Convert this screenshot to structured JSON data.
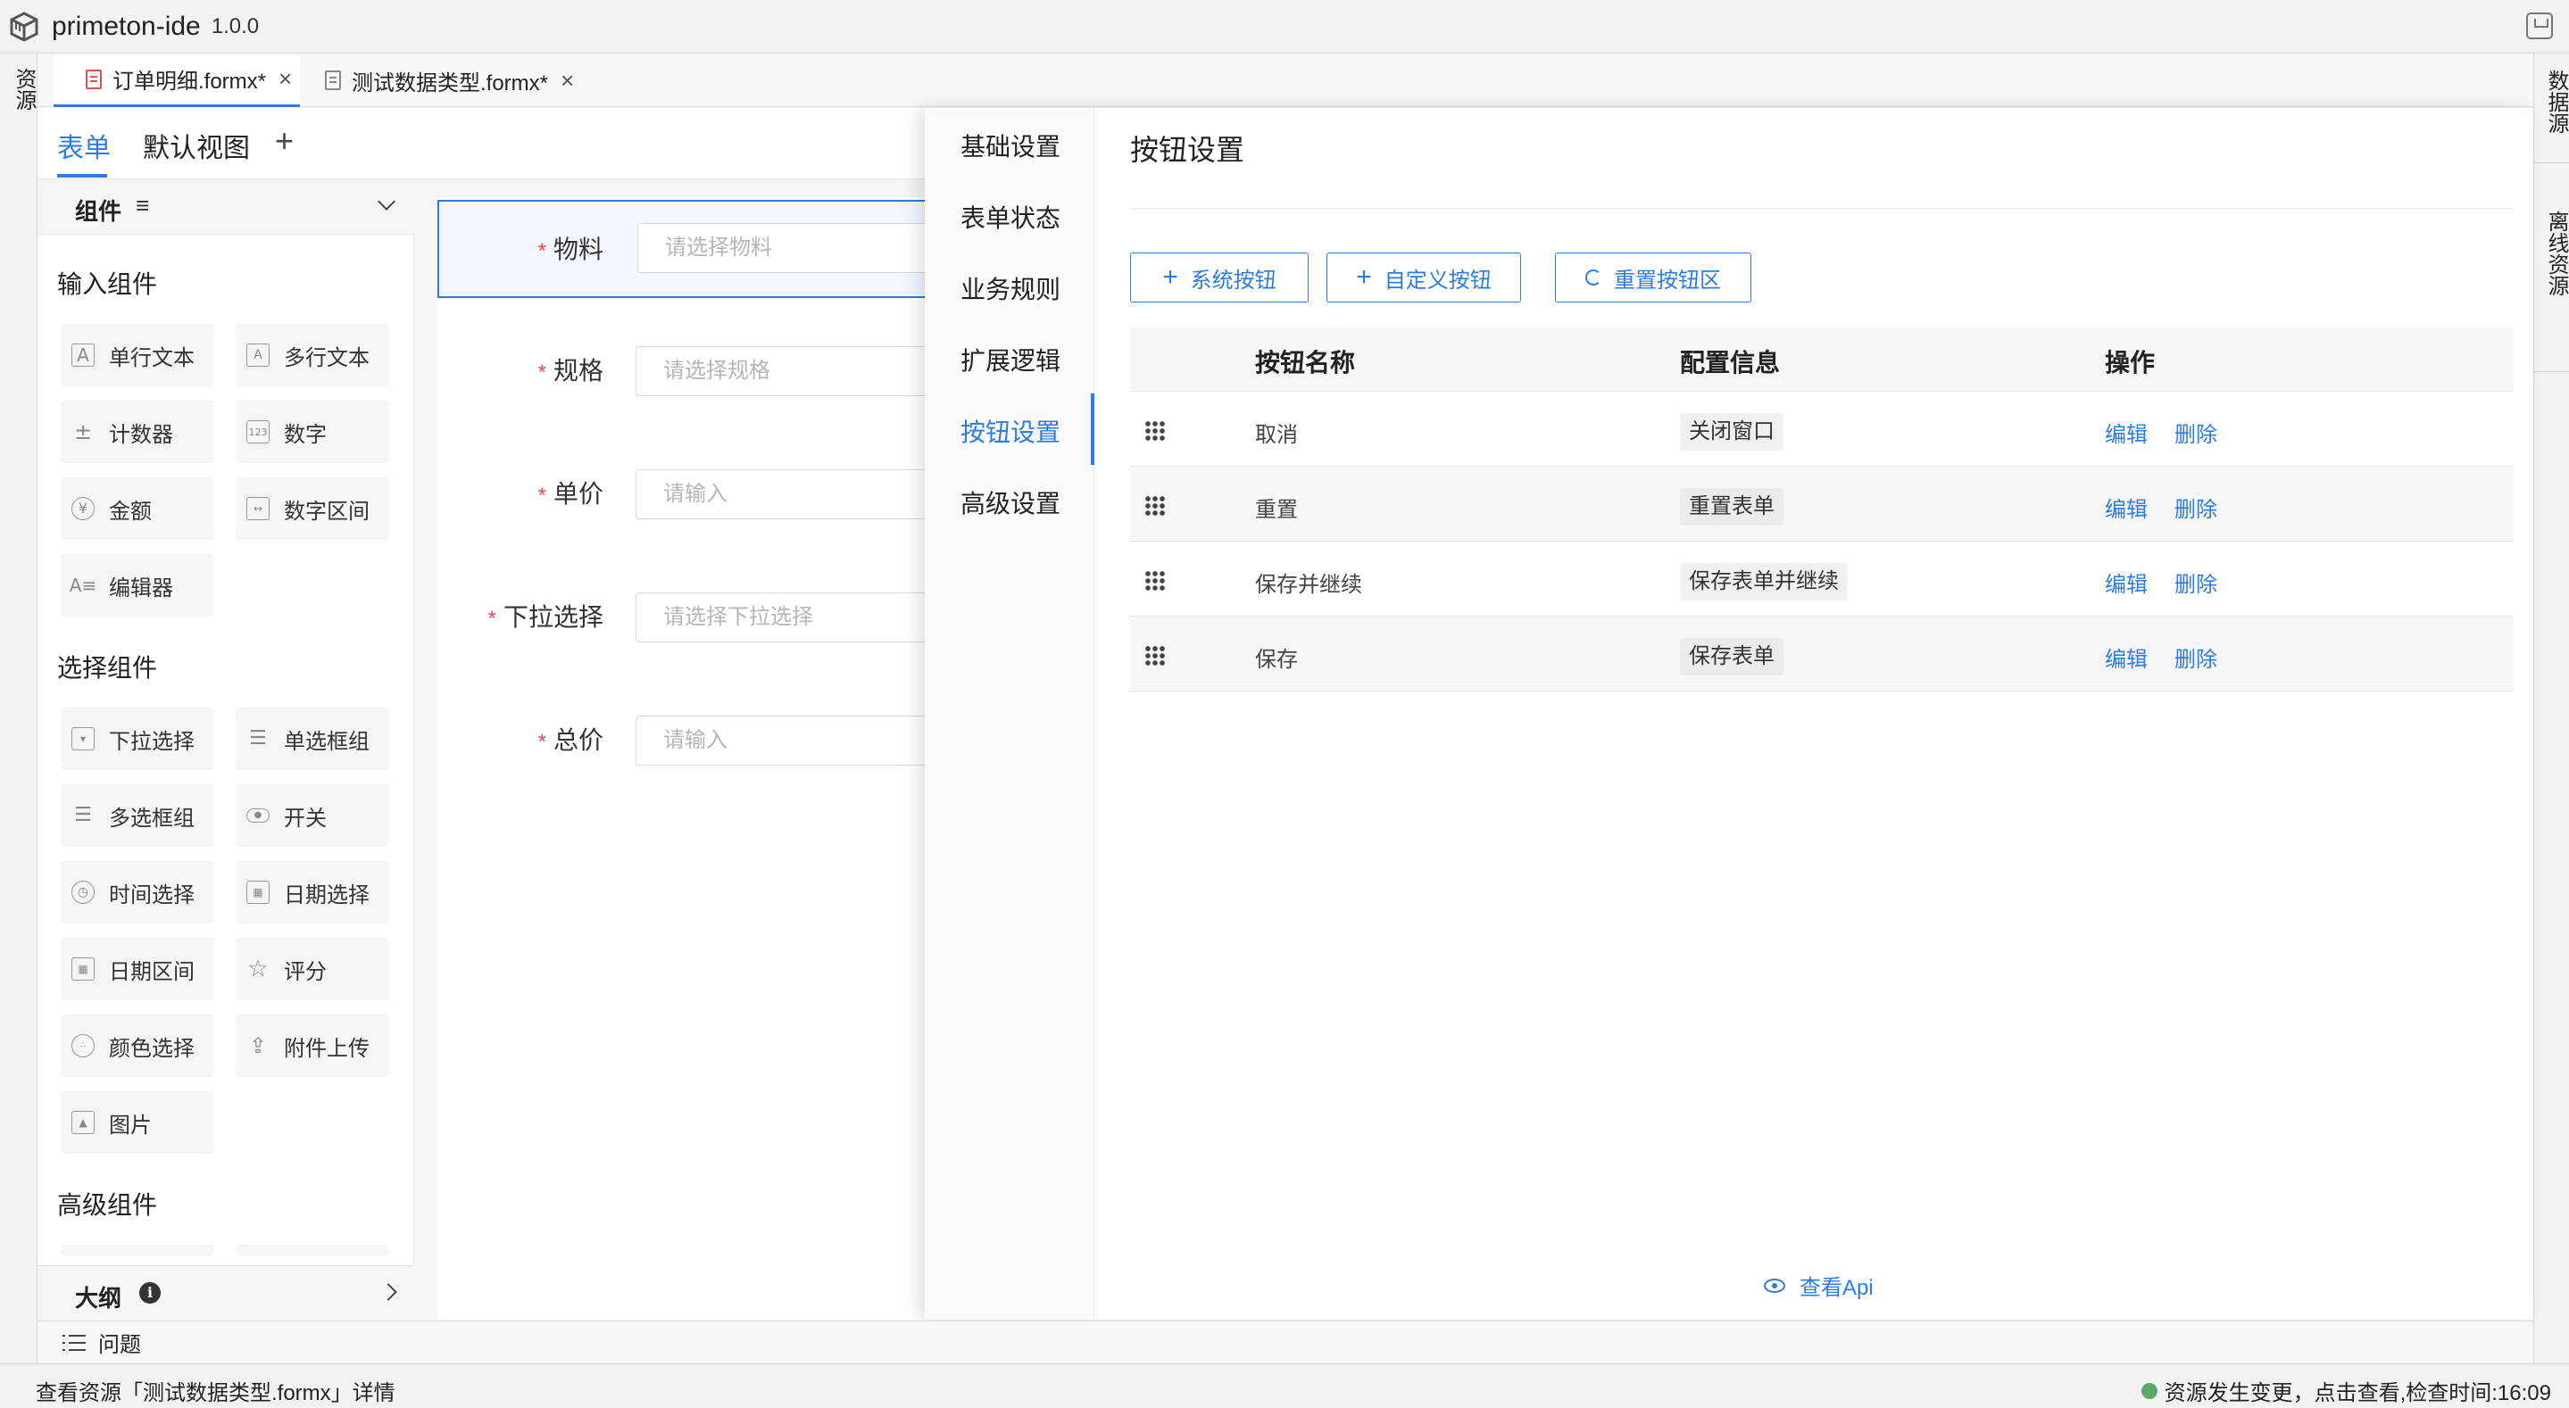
{
  "app": {
    "title": "primeton-ide",
    "version": "1.0.0"
  },
  "left_strip": {
    "resources": "资源"
  },
  "right_strip": {
    "data_source": "数据源",
    "offline_resources": "离线资源"
  },
  "editor_tabs": [
    {
      "label": "订单明细.formx*",
      "active": true
    },
    {
      "label": "测试数据类型.formx*",
      "active": false
    }
  ],
  "view_tabs": [
    {
      "label": "表单",
      "active": true
    },
    {
      "label": "默认视图",
      "active": false
    }
  ],
  "view_tabs_add": "+",
  "components": {
    "header": "组件",
    "header_menu": "≡",
    "groups": [
      {
        "title": "输入组件",
        "items": [
          "单行文本",
          "多行文本",
          "计数器",
          "数字",
          "金额",
          "数字区间",
          "编辑器"
        ]
      },
      {
        "title": "选择组件",
        "items": [
          "下拉选择",
          "单选框组",
          "多选框组",
          "开关",
          "时间选择",
          "日期选择",
          "日期区间",
          "评分",
          "颜色选择",
          "附件上传",
          "图片"
        ]
      },
      {
        "title": "高级组件",
        "items": []
      }
    ],
    "outline": "大纲"
  },
  "form": {
    "fields": [
      {
        "label": "物料",
        "placeholder": "请选择物料",
        "required": true,
        "selected": true
      },
      {
        "label": "规格",
        "placeholder": "请选择规格",
        "required": true,
        "selected": false
      },
      {
        "label": "单价",
        "placeholder": "请输入",
        "required": true,
        "selected": false
      },
      {
        "label": "下拉选择",
        "placeholder": "请选择下拉选择",
        "required": true,
        "selected": false
      },
      {
        "label": "总价",
        "placeholder": "请输入",
        "required": true,
        "selected": false
      }
    ],
    "required_mark": "*"
  },
  "drawer": {
    "nav": [
      "基础设置",
      "表单状态",
      "业务规则",
      "扩展逻辑",
      "按钮设置",
      "高级设置"
    ],
    "active_nav": "按钮设置",
    "title": "按钮设置",
    "toolbar": {
      "system_button": "系统按钮",
      "custom_button": "自定义按钮",
      "reset_area": "重置按钮区"
    },
    "table": {
      "headers": [
        "按钮名称",
        "配置信息",
        "操作"
      ],
      "rows": [
        {
          "name": "取消",
          "config": "关闭窗口",
          "edit": "编辑",
          "delete": "删除"
        },
        {
          "name": "重置",
          "config": "重置表单",
          "edit": "编辑",
          "delete": "删除"
        },
        {
          "name": "保存并继续",
          "config": "保存表单并继续",
          "edit": "编辑",
          "delete": "删除"
        },
        {
          "name": "保存",
          "config": "保存表单",
          "edit": "编辑",
          "delete": "删除"
        }
      ]
    },
    "view_api": "查看Api"
  },
  "problems": {
    "label": "问题"
  },
  "status": {
    "left": "查看资源「测试数据类型.formx」详情",
    "right": "资源发生变更，点击查看,检查时间:16:09",
    "dot_color": "#5aa96a"
  },
  "colors": {
    "accent": "#2d7be5",
    "required": "#e84747"
  }
}
